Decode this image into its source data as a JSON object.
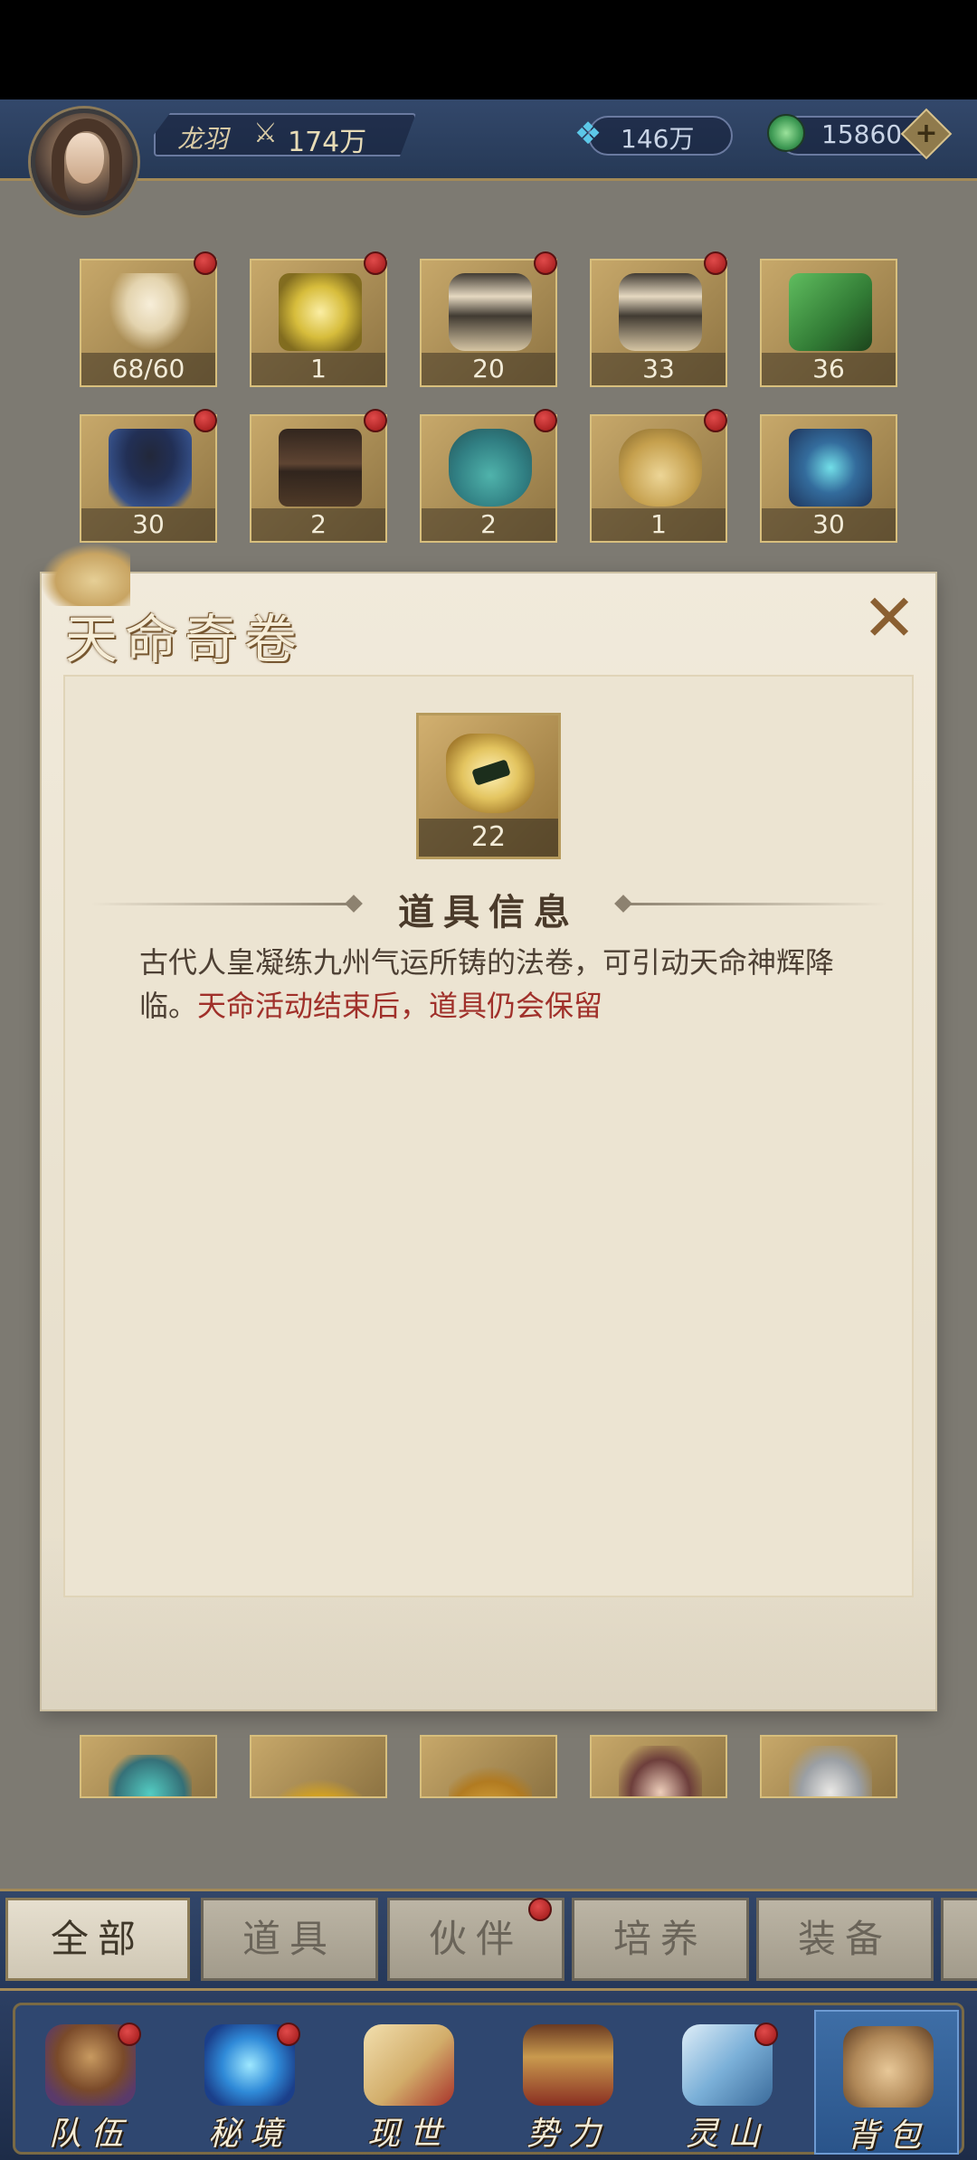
{
  "header": {
    "player_name": "龙羽",
    "power": "174万",
    "currency_primary": {
      "icon": "crystal-icon",
      "value": "146万"
    },
    "currency_secondary": {
      "icon": "jade-coin-icon",
      "value": "15860",
      "add_label": "+"
    }
  },
  "inventory": {
    "row1": [
      {
        "icon": "feather-icon",
        "count": "68/60",
        "badge": true,
        "puzzle": true
      },
      {
        "icon": "golden-talisman-icon",
        "count": "1",
        "badge": true
      },
      {
        "icon": "treasure-chest-icon",
        "count": "20",
        "badge": true
      },
      {
        "icon": "treasure-chest-icon",
        "count": "33",
        "badge": true
      },
      {
        "icon": "jade-box-icon",
        "count": "36",
        "badge": false
      }
    ],
    "row2": [
      {
        "icon": "shadow-figure-icon",
        "count": "30",
        "badge": true
      },
      {
        "icon": "dark-chest-icon",
        "count": "2",
        "badge": true
      },
      {
        "icon": "blue-pouch-icon",
        "count": "2",
        "badge": true
      },
      {
        "icon": "gold-pouch-icon",
        "count": "1",
        "badge": true
      },
      {
        "icon": "blue-box-icon",
        "count": "30",
        "badge": false
      }
    ]
  },
  "modal": {
    "title": "天命奇卷",
    "close_icon": "close-icon",
    "item": {
      "icon": "scroll-icon",
      "count": "22"
    },
    "section_title": "道具信息",
    "description_normal": "古代人皇凝练九州气运所铸的法卷，可引动天命神辉降临。",
    "description_highlight": "天命活动结束后，道具仍会保留",
    "highlight_color": "#a0302a"
  },
  "tabs": [
    {
      "label": "全部",
      "active": true,
      "badge": false
    },
    {
      "label": "道具",
      "active": false,
      "badge": false
    },
    {
      "label": "伙伴",
      "active": false,
      "badge": true
    },
    {
      "label": "培养",
      "active": false,
      "badge": false
    },
    {
      "label": "装备",
      "active": false,
      "badge": false
    }
  ],
  "nav": [
    {
      "label": "队伍",
      "icon": "team-icon",
      "badge": true,
      "active": false
    },
    {
      "label": "秘境",
      "icon": "vortex-icon",
      "badge": true,
      "active": false
    },
    {
      "label": "现世",
      "icon": "scroll-map-icon",
      "badge": false,
      "active": false
    },
    {
      "label": "势力",
      "icon": "pavilion-icon",
      "badge": false,
      "active": false
    },
    {
      "label": "灵山",
      "icon": "mountain-icon",
      "badge": true,
      "active": false
    },
    {
      "label": "背包",
      "icon": "bag-icon",
      "badge": false,
      "active": true
    }
  ],
  "colors": {
    "header_bg": "#2c3f63",
    "slot_gold": "#c7a86a",
    "badge_red": "#c0302a"
  }
}
